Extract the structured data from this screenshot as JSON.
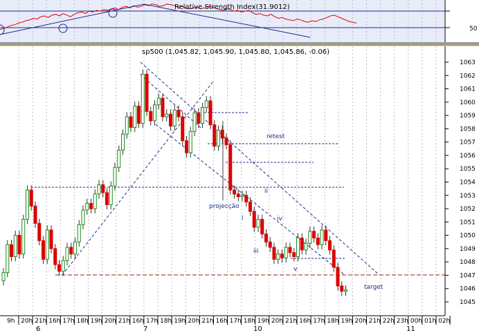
{
  "rsi_panel": {
    "title": "Relative Strength Index(31.9012)",
    "level_label": "50",
    "level": 50,
    "ylim": [
      27,
      80
    ],
    "values": [
      43,
      44,
      46,
      48,
      49,
      51,
      52,
      54,
      55,
      57,
      56,
      59,
      60,
      58,
      61,
      62,
      60,
      63,
      61,
      59,
      62,
      64,
      65,
      63,
      66,
      65,
      67,
      66,
      68,
      67,
      69,
      70,
      68,
      71,
      72,
      70,
      73,
      71,
      72,
      74,
      73,
      75,
      74,
      72,
      73,
      75,
      74,
      73,
      71,
      72,
      70,
      69,
      70,
      71,
      69,
      70,
      72,
      71,
      70,
      68,
      67,
      69,
      68,
      66,
      67,
      65,
      66,
      67,
      64,
      62,
      63,
      61,
      60,
      62,
      59,
      57,
      58,
      56,
      55,
      54,
      56,
      55,
      53,
      52,
      54,
      53,
      55,
      56,
      58,
      60,
      61,
      59,
      57,
      55,
      53,
      52,
      51
    ],
    "colors": {
      "background": "#e8ecf8",
      "rsi_line": "#e00000",
      "trend_line": "#1c2a8c",
      "level_line": "#1c2a8c"
    }
  },
  "chart_data": {
    "type": "candlestick",
    "title": "sp500 (1,045.82, 1,045.90, 1,045.80, 1,045.86, -0.06)",
    "ylim": [
      1044.4,
      1063.6
    ],
    "y_ticks": [
      1045,
      1046,
      1047,
      1048,
      1049,
      1050,
      1051,
      1052,
      1053,
      1054,
      1055,
      1056,
      1057,
      1058,
      1059,
      1060,
      1061,
      1062,
      1063
    ],
    "x_ticks": [
      "9h",
      "20h",
      "21h",
      "16h",
      "17h",
      "18h",
      "19h",
      "20h",
      "21h",
      "16h",
      "17h",
      "18h",
      "19h",
      "20h",
      "21h",
      "16h",
      "17h",
      "18h",
      "19h",
      "20h",
      "21h",
      "16h",
      "17h",
      "18h",
      "19h",
      "20h",
      "21h",
      "22h",
      "23h",
      "00h",
      "01h",
      "02h"
    ],
    "day_labels": [
      "6",
      "7",
      "10",
      "11"
    ],
    "closes": [
      1047.2,
      1049.3,
      1048.4,
      1050.0,
      1048.6,
      1051.2,
      1053.4,
      1052.2,
      1050.9,
      1049.6,
      1048.2,
      1050.4,
      1049.0,
      1047.8,
      1047.3,
      1048.1,
      1049.1,
      1048.6,
      1049.5,
      1050.8,
      1051.9,
      1052.4,
      1052.0,
      1053.1,
      1053.8,
      1053.2,
      1052.3,
      1053.7,
      1055.1,
      1056.4,
      1057.6,
      1058.9,
      1058.1,
      1059.7,
      1058.4,
      1062.1,
      1059.3,
      1058.6,
      1059.8,
      1060.3,
      1058.9,
      1059.1,
      1058.2,
      1059.4,
      1058.9,
      1057.1,
      1056.2,
      1057.8,
      1059.2,
      1058.4,
      1059.6,
      1060.1,
      1058.3,
      1056.7,
      1057.9,
      1057.3,
      1056.8,
      1053.4,
      1053.1,
      1052.9,
      1053.0,
      1052.5,
      1051.8,
      1050.6,
      1051.2,
      1050.1,
      1049.5,
      1049.1,
      1048.2,
      1048.6,
      1048.3,
      1049.1,
      1048.7,
      1048.4,
      1049.8,
      1048.9,
      1049.4,
      1050.3,
      1049.8,
      1049.3,
      1050.4,
      1049.6,
      1048.9,
      1047.6,
      1046.2,
      1045.8,
      1045.9
    ],
    "bull_color": "#1a8a1a",
    "bear_color": "#dd0000",
    "annotations": [
      "retest",
      "projecção",
      "i",
      "ii",
      "iii",
      "iv",
      "v",
      "target"
    ],
    "horizontal_levels": [
      1057.0,
      1055.4,
      1053.4,
      1048.2,
      1047.0
    ],
    "grid": true
  }
}
